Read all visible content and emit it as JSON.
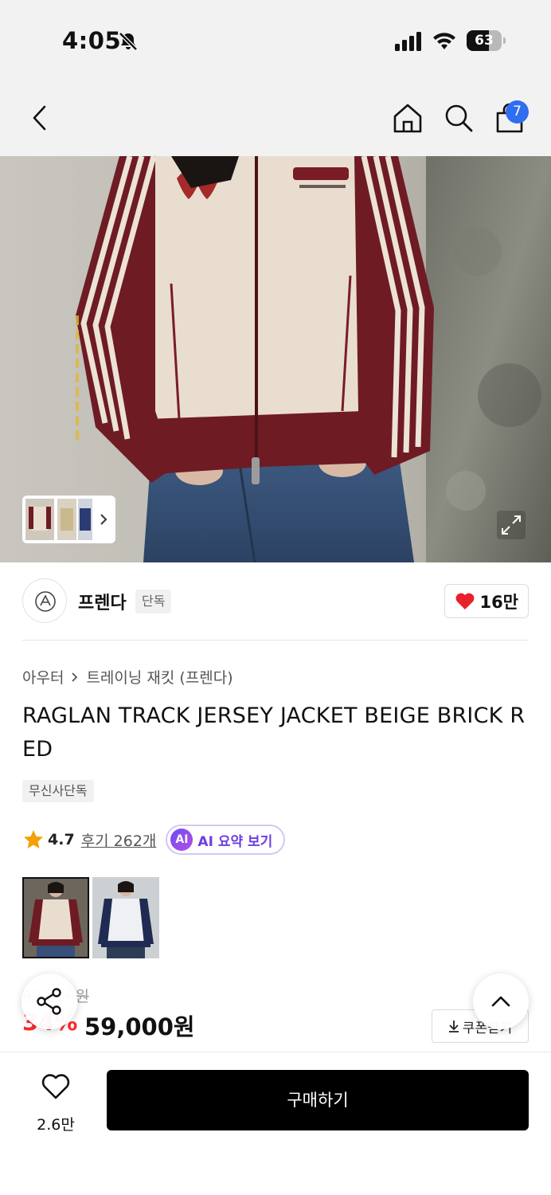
{
  "status_bar": {
    "time": "4:05",
    "battery": "63",
    "battery_level": 0.63
  },
  "nav": {
    "cart_count": "7"
  },
  "hero": {
    "thumbs_icon": "chevron-right-icon",
    "expand_icon": "expand-icon"
  },
  "brand": {
    "name": "프렌다",
    "tag": "단독",
    "likes": "16만"
  },
  "breadcrumb": {
    "category": "아우터",
    "subcategory": "트레이닝 재킷 (프렌다)"
  },
  "product": {
    "title": "RAGLAN TRACK JERSEY JACKET BEIGE BRICK RED",
    "exclusive": "무신사단독"
  },
  "rating": {
    "score": "4.7",
    "reviews": "후기 262개",
    "ai_badge": "AI",
    "ai_label": "AI 요약 보기"
  },
  "price": {
    "original": "89,000원",
    "discount": "34%",
    "sale": "59,000원",
    "coupon_label": "쿠폰받기"
  },
  "bottom": {
    "wish_count": "2.6만",
    "buy_label": "구매하기"
  },
  "colors": {
    "accent": "#2f6ef0",
    "discount": "#ff2b2b",
    "heart": "#e8202b",
    "brick": "#7a1c26"
  }
}
